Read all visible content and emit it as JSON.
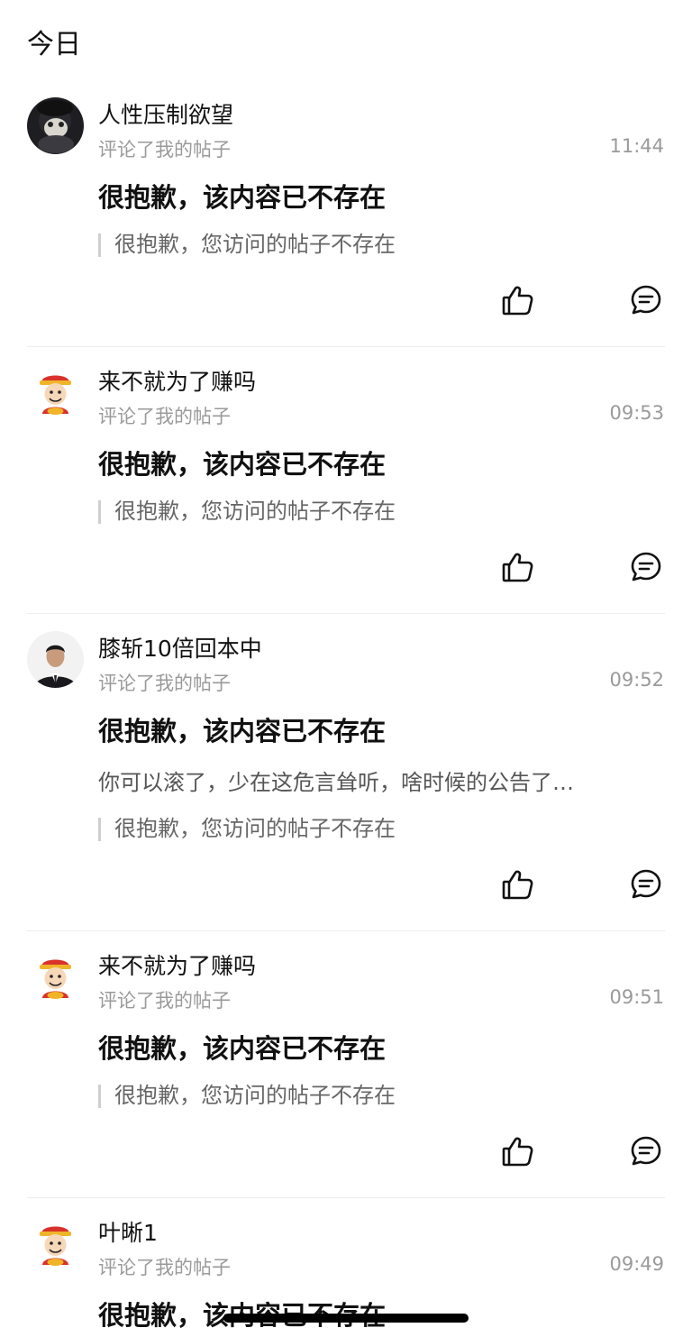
{
  "section": {
    "title": "今日"
  },
  "colors": {
    "text": "#111111",
    "muted": "#9a9a9a",
    "quote_bar": "#cfcfcf",
    "divider": "#ededed"
  },
  "notifications": [
    {
      "username": "人性压制欲望",
      "action": "评论了我的帖子",
      "time": "11:44",
      "headline": "很抱歉，该内容已不存在",
      "reply": "",
      "quote": "很抱歉，您访问的帖子不存在",
      "avatar": "cat-photo-avatar",
      "like_icon": "thumbs-up-icon",
      "comment_icon": "comment-bubble-icon"
    },
    {
      "username": "来不就为了赚吗",
      "action": "评论了我的帖子",
      "time": "09:53",
      "headline": "很抱歉，该内容已不存在",
      "reply": "",
      "quote": "很抱歉，您访问的帖子不存在",
      "avatar": "fortune-god-avatar",
      "like_icon": "thumbs-up-icon",
      "comment_icon": "comment-bubble-icon"
    },
    {
      "username": "膝斩10倍回本中",
      "action": "评论了我的帖子",
      "time": "09:52",
      "headline": "很抱歉，该内容已不存在",
      "reply": "你可以滚了，少在这危言耸听，啥时候的公告了…",
      "quote": "很抱歉，您访问的帖子不存在",
      "avatar": "man-in-suit-avatar",
      "like_icon": "thumbs-up-icon",
      "comment_icon": "comment-bubble-icon"
    },
    {
      "username": "来不就为了赚吗",
      "action": "评论了我的帖子",
      "time": "09:51",
      "headline": "很抱歉，该内容已不存在",
      "reply": "",
      "quote": "很抱歉，您访问的帖子不存在",
      "avatar": "fortune-god-avatar",
      "like_icon": "thumbs-up-icon",
      "comment_icon": "comment-bubble-icon"
    },
    {
      "username": "叶晰1",
      "action": "评论了我的帖子",
      "time": "09:49",
      "headline": "很抱歉，该内容已不存在",
      "reply": "",
      "quote": "",
      "avatar": "fortune-god-avatar",
      "like_icon": "thumbs-up-icon",
      "comment_icon": "comment-bubble-icon"
    }
  ]
}
